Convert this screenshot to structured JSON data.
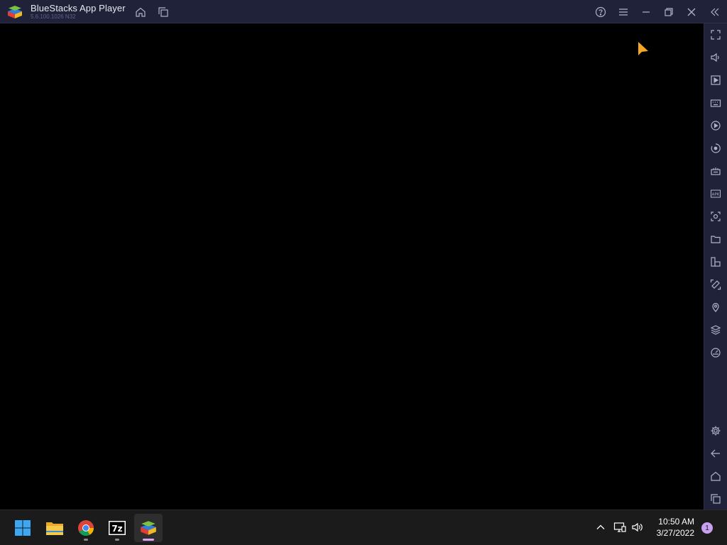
{
  "window": {
    "title": "BlueStacks App Player",
    "version": "5.6.100.1026 N32"
  },
  "titlebar_icons": {
    "home": "home-icon",
    "multi_instance": "multi-instance-icon",
    "help": "help-icon",
    "menu": "menu-icon",
    "minimize": "minimize-icon",
    "restore": "restore-icon",
    "close": "close-icon",
    "collapse": "collapse-sidebar-icon"
  },
  "sidebar_icons": [
    "fullscreen-icon",
    "volume-icon",
    "media-manager-icon",
    "keyboard-icon",
    "macro-record-icon",
    "macro-play-icon",
    "game-controls-icon",
    "apk-install-icon",
    "screenshot-icon",
    "folder-icon",
    "multi-instance-manager-icon",
    "rotate-icon",
    "location-icon",
    "layers-icon",
    "performance-icon",
    "settings-icon",
    "back-icon",
    "android-home-icon",
    "recent-apps-icon"
  ],
  "taskbar": {
    "apps": [
      "start-icon",
      "file-explorer-icon",
      "chrome-icon",
      "7zip-icon",
      "bluestacks-icon"
    ],
    "time": "10:50 AM",
    "date": "3/27/2022",
    "notification_count": "1"
  },
  "colors": {
    "chrome_bg": "#1f2239",
    "screen_bg": "#000000",
    "taskbar_bg": "#1b1b1b",
    "cursor": "#f5a623"
  }
}
